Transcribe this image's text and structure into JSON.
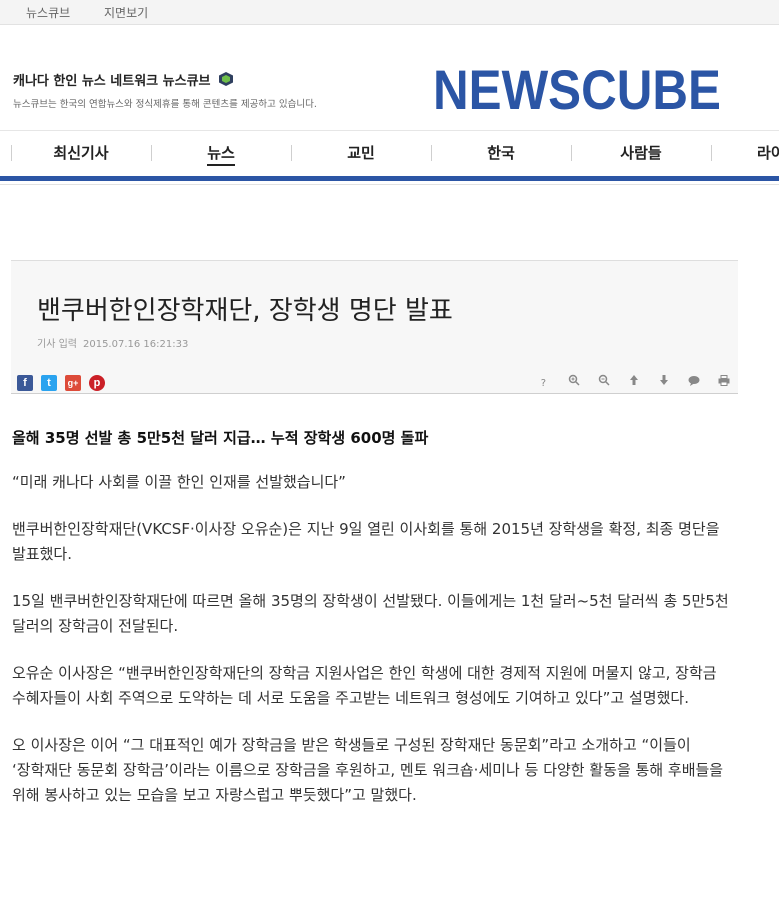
{
  "topbar": {
    "links": [
      "뉴스큐브",
      "지면보기"
    ]
  },
  "brand": {
    "title": "캐나다 한인 뉴스 네트워크 뉴스큐브",
    "subtitle": "뉴스큐브는 한국의 연합뉴스와 정식제휴를 통해 콘텐츠를 제공하고 있습니다.",
    "wordmark": "NEWSCUBE",
    "accent_color": "#2b55a5"
  },
  "nav": {
    "items": [
      "최신기사",
      "뉴스",
      "교민",
      "한국",
      "사람들",
      "라이"
    ],
    "active_index": 1
  },
  "article": {
    "headline": "밴쿠버한인장학재단, 장학생 명단 발표",
    "meta_label": "기사 입력",
    "meta_date": "2015.07.16 16:21:33",
    "share_icons": [
      "facebook-icon",
      "twitter-icon",
      "google-plus-icon",
      "pinterest-icon"
    ],
    "tool_icons": [
      "help-icon",
      "zoom-in-icon",
      "zoom-out-icon",
      "arrow-up-icon",
      "arrow-down-icon",
      "comment-icon",
      "print-icon"
    ],
    "paragraphs": [
      "올해 35명 선발 총 5만5천 달러 지급… 누적 장학생 600명 돌파",
      "“미래 캐나다 사회를 이끌 한인 인재를 선발했습니다”",
      "밴쿠버한인장학재단(VKCSF·이사장 오유순)은 지난 9일 열린 이사회를 통해 2015년 장학생을 확정, 최종 명단을 발표했다.",
      "15일 밴쿠버한인장학재단에 따르면 올해 35명의 장학생이 선발됐다. 이들에게는 1천 달러~5천 달러씩 총 5만5천 달러의 장학금이 전달된다.",
      "오유순 이사장은 “밴쿠버한인장학재단의 장학금 지원사업은 한인 학생에 대한 경제적 지원에 머물지 않고, 장학금 수혜자들이 사회 주역으로 도약하는 데 서로 도움을 주고받는 네트워크 형성에도 기여하고 있다”고 설명했다.",
      "오 이사장은 이어 “그 대표적인 예가 장학금을 받은 학생들로 구성된 장학재단 동문회”라고 소개하고 “이들이 ‘장학재단 동문회 장학금’이라는 이름으로 장학금을 후원하고, 멘토 워크숍·세미나 등 다양한 활동을 통해 후배들을 위해 봉사하고 있는 모습을 보고 자랑스럽고 뿌듯했다”고 말했다."
    ]
  }
}
